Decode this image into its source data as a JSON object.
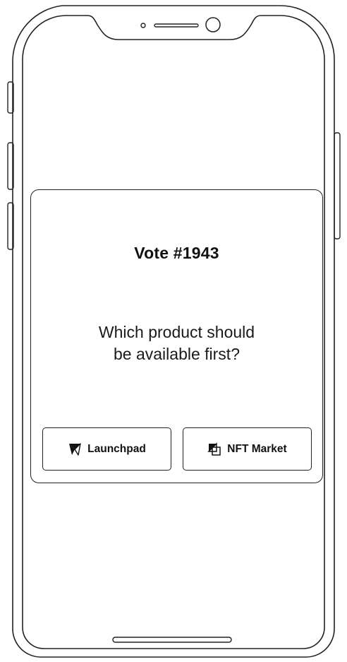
{
  "vote": {
    "title": "Vote #1943",
    "question_line1": "Which product should",
    "question_line2": "be available first?"
  },
  "options": [
    {
      "label": "Launchpad",
      "icon": "rocket-launch-icon"
    },
    {
      "label": "NFT Market",
      "icon": "nft-market-icon"
    }
  ],
  "colors": {
    "stroke": "#222222",
    "background": "#ffffff",
    "text": "#111111"
  }
}
